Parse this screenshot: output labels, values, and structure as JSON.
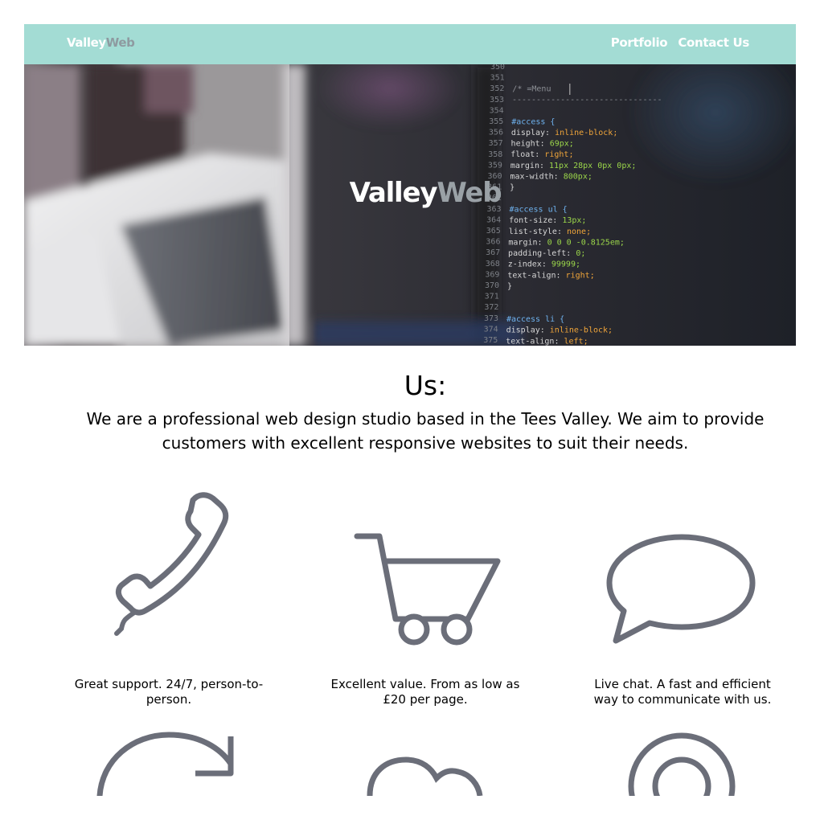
{
  "nav": {
    "brand_part1": "Valley",
    "brand_part2": "Web",
    "links": [
      "Portfolio",
      "Contact Us"
    ]
  },
  "hero": {
    "title_part1": "Valley",
    "title_part2": "Web",
    "code_lines": [
      {
        "n": "350",
        "t": ""
      },
      {
        "n": "351",
        "t": ""
      },
      {
        "n": "352",
        "t": "/* =Menu"
      },
      {
        "n": "353",
        "t": "-------------------------------"
      },
      {
        "n": "354",
        "t": ""
      },
      {
        "n": "355",
        "t": "#access {"
      },
      {
        "n": "356",
        "t": "    display: inline-block;"
      },
      {
        "n": "357",
        "t": "    height: 69px;"
      },
      {
        "n": "358",
        "t": "    float: right;"
      },
      {
        "n": "359",
        "t": "    margin: 11px 28px 0px 0px;"
      },
      {
        "n": "360",
        "t": "    max-width: 800px;"
      },
      {
        "n": "361",
        "t": "}"
      },
      {
        "n": "362",
        "t": ""
      },
      {
        "n": "363",
        "t": "#access ul {"
      },
      {
        "n": "364",
        "t": "    font-size: 13px;"
      },
      {
        "n": "365",
        "t": "    list-style: none;"
      },
      {
        "n": "366",
        "t": "    margin: 0 0 0 -0.8125em;"
      },
      {
        "n": "367",
        "t": "    padding-left: 0;"
      },
      {
        "n": "368",
        "t": "    z-index: 99999;"
      },
      {
        "n": "369",
        "t": "    text-align: right;"
      },
      {
        "n": "370",
        "t": "}"
      },
      {
        "n": "371",
        "t": ""
      },
      {
        "n": "372",
        "t": ""
      },
      {
        "n": "373",
        "t": "#access li {"
      },
      {
        "n": "374",
        "t": "    display: inline-block;"
      },
      {
        "n": "375",
        "t": "    text-align: left;"
      }
    ]
  },
  "about": {
    "title": "Us:",
    "text": "We are a professional web design studio based in the Tees Valley. We aim to provide customers with excellent responsive websites to suit their needs."
  },
  "features": [
    {
      "icon": "phone-icon",
      "caption": "Great support. 24/7, person-to-person."
    },
    {
      "icon": "shopping-cart-icon",
      "caption": "Excellent value. From as low as £20 per page."
    },
    {
      "icon": "speech-bubble-icon",
      "caption": "Live chat. A fast and efficient way to communicate with us."
    }
  ],
  "features_row2": [
    {
      "icon": "refresh-icon"
    },
    {
      "icon": "cloud-icon"
    },
    {
      "icon": "target-icon"
    }
  ],
  "colors": {
    "nav_bg": "#a3dcd4",
    "icon_stroke": "#6b6e79",
    "brand_accent": "#8e9aa0"
  }
}
